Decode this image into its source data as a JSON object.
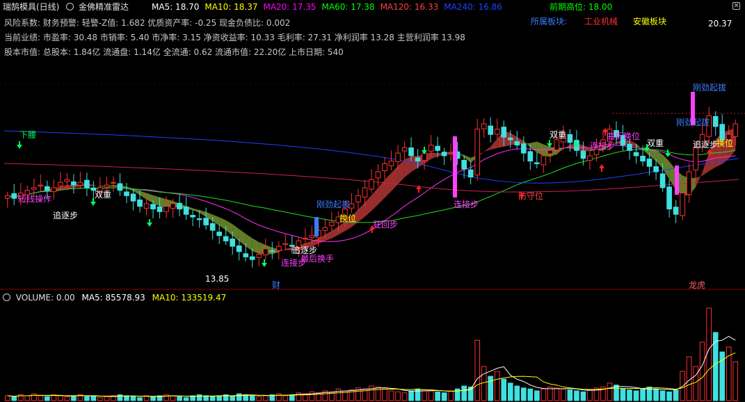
{
  "header": {
    "stock_name": "瑞鹄模具(日线)",
    "indicator_name": "金佛精准雷达",
    "ma": [
      {
        "label": "MA5: 18.70",
        "color": "#ffffff"
      },
      {
        "label": "MA10: 18.37",
        "color": "#ffff00"
      },
      {
        "label": "MA20: 17.35",
        "color": "#ff00ff"
      },
      {
        "label": "MA60: 17.38",
        "color": "#00ff00"
      },
      {
        "label": "MA120: 16.33",
        "color": "#ff4040"
      },
      {
        "label": "MA240: 16.86",
        "color": "#2040ff"
      }
    ],
    "prev_high": "前期高位: 18.00"
  },
  "info_lines": [
    "风险系数: 财务预警: 轻警-Z值: 1.682 优质资产率: -0.25 现金负债比: 0.002",
    "当前业绩: 市盈率: 30.48 市销率: 5.40 市净率: 3.15 净资收益率: 10.33 毛利率: 27.31 净利润率 13.28 主营利润率 13.98",
    "股本市值: 总股本: 1.84亿 流通盘: 1.14亿 全流通: 0.62 流通市值: 22.20亿 上市日期: 540"
  ],
  "sectors": [
    {
      "label": "所属板块:",
      "color": "#3a7dff"
    },
    {
      "label": "工业机械",
      "color": "#ff3030"
    },
    {
      "label": "安徽板块",
      "color": "#ffff00"
    }
  ],
  "price_labels": {
    "high": "20.37",
    "low": "13.85"
  },
  "volume_header": {
    "volume": "VOLUME: 0.00",
    "ma5": "MA5: 85578.93",
    "ma10": "MA10: 133519.47"
  },
  "bottom_markers": [
    {
      "label": "财",
      "color": "#3a7dff"
    },
    {
      "label": "龙虎",
      "color": "#ff6060"
    }
  ],
  "signals": [
    {
      "label": "下腰",
      "color": "#00ff60"
    },
    {
      "label": "双重",
      "color": "#ffffff"
    },
    {
      "label": "追逐步",
      "color": "#ffffff"
    },
    {
      "label": "短线操作",
      "color": "#ff40ff"
    },
    {
      "label": "追逐步",
      "color": "#ffffff"
    },
    {
      "label": "连接步",
      "color": "#ff40ff"
    },
    {
      "label": "最后换手",
      "color": "#ff40ff"
    },
    {
      "label": "刚劲起拔",
      "color": "#3a7dff"
    },
    {
      "label": "换位",
      "color": "#ffff00"
    },
    {
      "label": "狂回步",
      "color": "#ff40ff"
    },
    {
      "label": "连接步",
      "color": "#ff40ff"
    },
    {
      "label": "防守位",
      "color": "#ff4040"
    },
    {
      "label": "双重",
      "color": "#ffffff"
    },
    {
      "label": "曲折换位",
      "color": "#ff40ff"
    },
    {
      "label": "连接步",
      "color": "#ff40ff"
    },
    {
      "label": "双重",
      "color": "#ffffff"
    },
    {
      "label": "刚劲起拔",
      "color": "#3a7dff"
    },
    {
      "label": "刚劲起拔",
      "color": "#3a7dff"
    },
    {
      "label": "追逐步",
      "color": "#ffffff"
    },
    {
      "label": "换位",
      "color": "#ffff00"
    }
  ],
  "chart_data": {
    "type": "candlestick",
    "ylim": [
      13.2,
      21.3
    ],
    "candles_close": [
      16.3,
      16.2,
      16.4,
      16.5,
      16.6,
      16.7,
      16.5,
      16.6,
      16.8,
      16.9,
      16.7,
      16.8,
      16.6,
      16.5,
      16.6,
      16.7,
      16.8,
      16.5,
      16.3,
      16.1,
      15.9,
      16.0,
      15.8,
      15.7,
      15.9,
      16.0,
      15.8,
      15.6,
      15.5,
      15.4,
      15.2,
      15.0,
      14.8,
      14.6,
      14.4,
      14.2,
      14.0,
      13.9,
      14.1,
      14.3,
      14.2,
      14.4,
      14.5,
      14.4,
      14.6,
      14.7,
      14.8,
      15.0,
      15.1,
      15.3,
      15.5,
      15.8,
      16.0,
      16.3,
      16.6,
      16.9,
      17.2,
      17.5,
      17.6,
      17.9,
      18.1,
      17.8,
      17.6,
      17.9,
      18.2,
      18.0,
      17.8,
      17.9,
      17.7,
      17.3,
      17.0,
      18.8,
      19.0,
      18.6,
      18.8,
      18.5,
      18.4,
      18.2,
      17.9,
      17.6,
      17.5,
      17.8,
      18.0,
      18.4,
      18.6,
      18.3,
      18.0,
      17.7,
      17.8,
      18.1,
      18.4,
      18.8,
      18.5,
      18.2,
      18.0,
      17.8,
      17.6,
      17.4,
      17.2,
      16.6,
      15.8,
      15.6,
      16.4,
      17.2,
      18.1,
      18.6,
      19.3,
      18.9,
      18.4,
      18.6,
      19.0
    ],
    "ma5_close": [
      18.7
    ],
    "ma_series": [
      "MA5",
      "MA10",
      "MA20",
      "MA60",
      "MA120",
      "MA240"
    ],
    "ma_values": [
      18.7,
      18.37,
      17.35,
      17.38,
      16.33,
      16.86
    ],
    "volume_ylim": [
      0,
      1
    ],
    "volume": [
      0.05,
      0.04,
      0.06,
      0.05,
      0.07,
      0.05,
      0.04,
      0.06,
      0.05,
      0.04,
      0.05,
      0.06,
      0.04,
      0.05,
      0.03,
      0.04,
      0.05,
      0.06,
      0.05,
      0.04,
      0.03,
      0.05,
      0.04,
      0.05,
      0.06,
      0.05,
      0.04,
      0.03,
      0.05,
      0.06,
      0.05,
      0.04,
      0.05,
      0.06,
      0.05,
      0.07,
      0.06,
      0.05,
      0.04,
      0.05,
      0.06,
      0.07,
      0.05,
      0.06,
      0.08,
      0.07,
      0.09,
      0.08,
      0.1,
      0.09,
      0.12,
      0.1,
      0.11,
      0.13,
      0.12,
      0.15,
      0.14,
      0.12,
      0.1,
      0.09,
      0.08,
      0.1,
      0.12,
      0.11,
      0.1,
      0.09,
      0.08,
      0.1,
      0.12,
      0.15,
      0.14,
      0.62,
      0.35,
      0.25,
      0.3,
      0.22,
      0.18,
      0.15,
      0.13,
      0.12,
      0.1,
      0.12,
      0.14,
      0.13,
      0.12,
      0.11,
      0.1,
      0.09,
      0.11,
      0.13,
      0.14,
      0.18,
      0.16,
      0.12,
      0.11,
      0.1,
      0.12,
      0.14,
      0.12,
      0.1,
      0.09,
      0.11,
      0.3,
      0.45,
      0.35,
      0.6,
      0.95,
      0.7,
      0.5,
      0.55,
      0.4
    ]
  }
}
